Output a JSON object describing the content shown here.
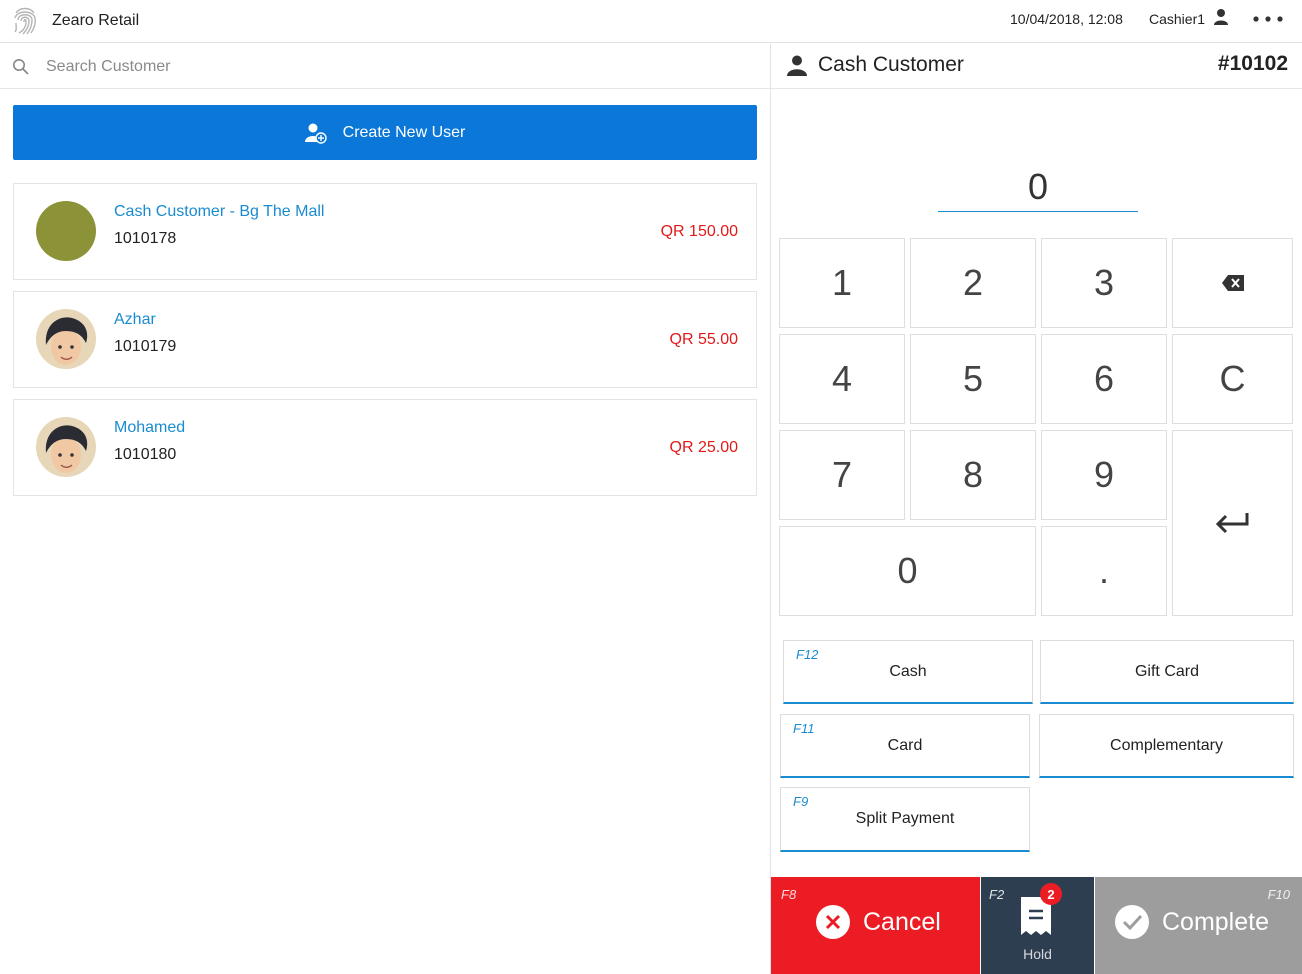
{
  "header": {
    "app_title": "Zearo Retail",
    "datetime": "10/04/2018, 12:08",
    "cashier": "Cashier1"
  },
  "search": {
    "placeholder": "Search Customer"
  },
  "create_button": {
    "label": "Create New User"
  },
  "customers": [
    {
      "name": "Cash Customer - Bg The Mall",
      "id": "1010178",
      "amount": "QR 150.00",
      "avatar": "olive-circle"
    },
    {
      "name": "Azhar",
      "id": "1010179",
      "amount": "QR 55.00",
      "avatar": "profile-photo"
    },
    {
      "name": "Mohamed",
      "id": "1010180",
      "amount": "QR 25.00",
      "avatar": "profile-photo"
    }
  ],
  "order": {
    "customer_name": "Cash Customer",
    "order_number": "#10102",
    "amount_display": "0"
  },
  "keypad": {
    "k1": "1",
    "k2": "2",
    "k3": "3",
    "k4": "4",
    "k5": "5",
    "k6": "6",
    "k7": "7",
    "k8": "8",
    "k9": "9",
    "k0": "0",
    "kdot": ".",
    "kclear": "C"
  },
  "payment_methods": {
    "cash": {
      "key": "F12",
      "label": "Cash"
    },
    "gift_card": {
      "label": "Gift Card"
    },
    "card": {
      "key": "F11",
      "label": "Card"
    },
    "complementary": {
      "label": "Complementary"
    },
    "split": {
      "key": "F9",
      "label": "Split Payment"
    }
  },
  "actions": {
    "cancel": {
      "key": "F8",
      "label": "Cancel"
    },
    "hold": {
      "key": "F2",
      "label": "Hold",
      "badge": "2"
    },
    "complete": {
      "key": "F10",
      "label": "Complete"
    }
  },
  "colors": {
    "accent_blue": "#0b77d8",
    "link_blue": "#1a8bd0",
    "amount_red": "#e01a1a",
    "cancel_red": "#ec1c24",
    "hold_navy": "#2d3e50",
    "complete_gray": "#9d9d9d",
    "avatar_olive": "#8b9237"
  }
}
